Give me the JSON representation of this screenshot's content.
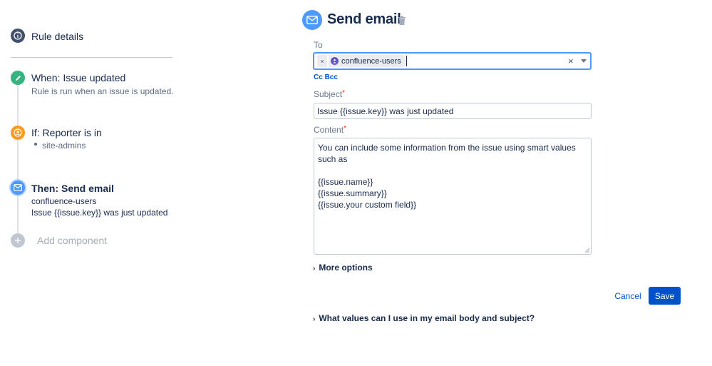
{
  "sidebar": {
    "rule_details": "Rule details",
    "when": {
      "title": "When: Issue updated",
      "description": "Rule is run when an issue is updated."
    },
    "if": {
      "title": "If: Reporter is in",
      "items": [
        "site-admins"
      ]
    },
    "then": {
      "title": "Then: Send email",
      "recipient": "confluence-users",
      "subject": "Issue {{issue.key}} was just updated"
    },
    "add_component": "Add component"
  },
  "panel": {
    "title": "Send email",
    "to": {
      "label": "To",
      "chip": "confluence-users",
      "chip_remove": "×",
      "clear": "×"
    },
    "cc_bcc": {
      "cc": "Cc",
      "bcc": "Bcc"
    },
    "subject": {
      "label": "Subject",
      "required": "*",
      "value": "Issue {{issue.key}} was just updated"
    },
    "content": {
      "label": "Content",
      "required": "*",
      "value": "You can include some information from the issue using smart values such as\n\n{{issue.name}}\n{{issue.summary}}\n{{issue.your custom field}}"
    },
    "more_options": "More options",
    "cancel": "Cancel",
    "save": "Save",
    "help_toggle": "What values can I use in my email body and subject?"
  },
  "colors": {
    "primary": "#0052cc",
    "focus": "#4c9aff",
    "success": "#36b37e",
    "warning": "#ff991f",
    "required": "#de350b"
  },
  "icons": [
    "info-icon",
    "pencil-icon",
    "user-icon",
    "mail-icon",
    "plus-icon",
    "trash-icon",
    "chevron-right-icon",
    "chevron-down-icon"
  ]
}
